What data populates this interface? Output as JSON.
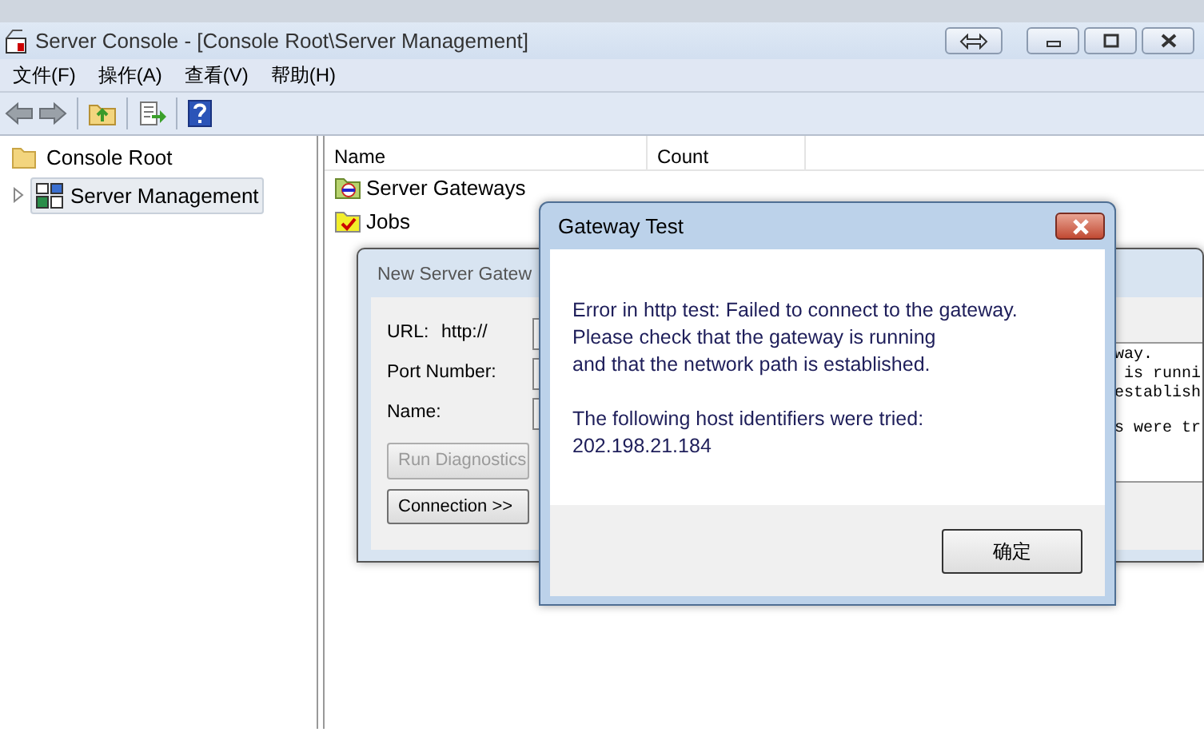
{
  "window": {
    "title": "Server Console - [Console Root\\Server Management]"
  },
  "menu": [
    "文件(F)",
    "操作(A)",
    "查看(V)",
    "帮助(H)"
  ],
  "tree": [
    {
      "label": "Console Root",
      "selected": false,
      "kind": "folder",
      "children": [
        {
          "label": "Server Management",
          "selected": true,
          "expanded": false,
          "kind": "server"
        }
      ]
    }
  ],
  "list": {
    "columns": [
      "Name",
      "Count"
    ],
    "rows": [
      {
        "name": "Server Gateways",
        "kind": "gateway"
      },
      {
        "name": "Jobs",
        "kind": "jobs"
      }
    ]
  },
  "new_gateway_dialog": {
    "title": "New Server Gatew",
    "fields": [
      {
        "label": "URL:",
        "prefix": "http://"
      },
      {
        "label": "Port Number:"
      },
      {
        "label": "Name:"
      }
    ],
    "buttons": [
      {
        "label": "Run Diagnostics",
        "disabled": true
      },
      {
        "label": "Connection >>",
        "disabled": false
      }
    ],
    "log": [
      [
        "way.",
        "is runni",
        "establish"
      ],
      [
        "s were tr"
      ]
    ]
  },
  "message_box": {
    "title": "Gateway Test",
    "paragraphs": [
      [
        "Error in http test: Failed to connect to the gateway.",
        "Please check that the gateway is running",
        "and that the network path is established."
      ],
      [
        "The following host identifiers were tried:",
        "202.198.21.184"
      ]
    ],
    "button": "确定"
  }
}
